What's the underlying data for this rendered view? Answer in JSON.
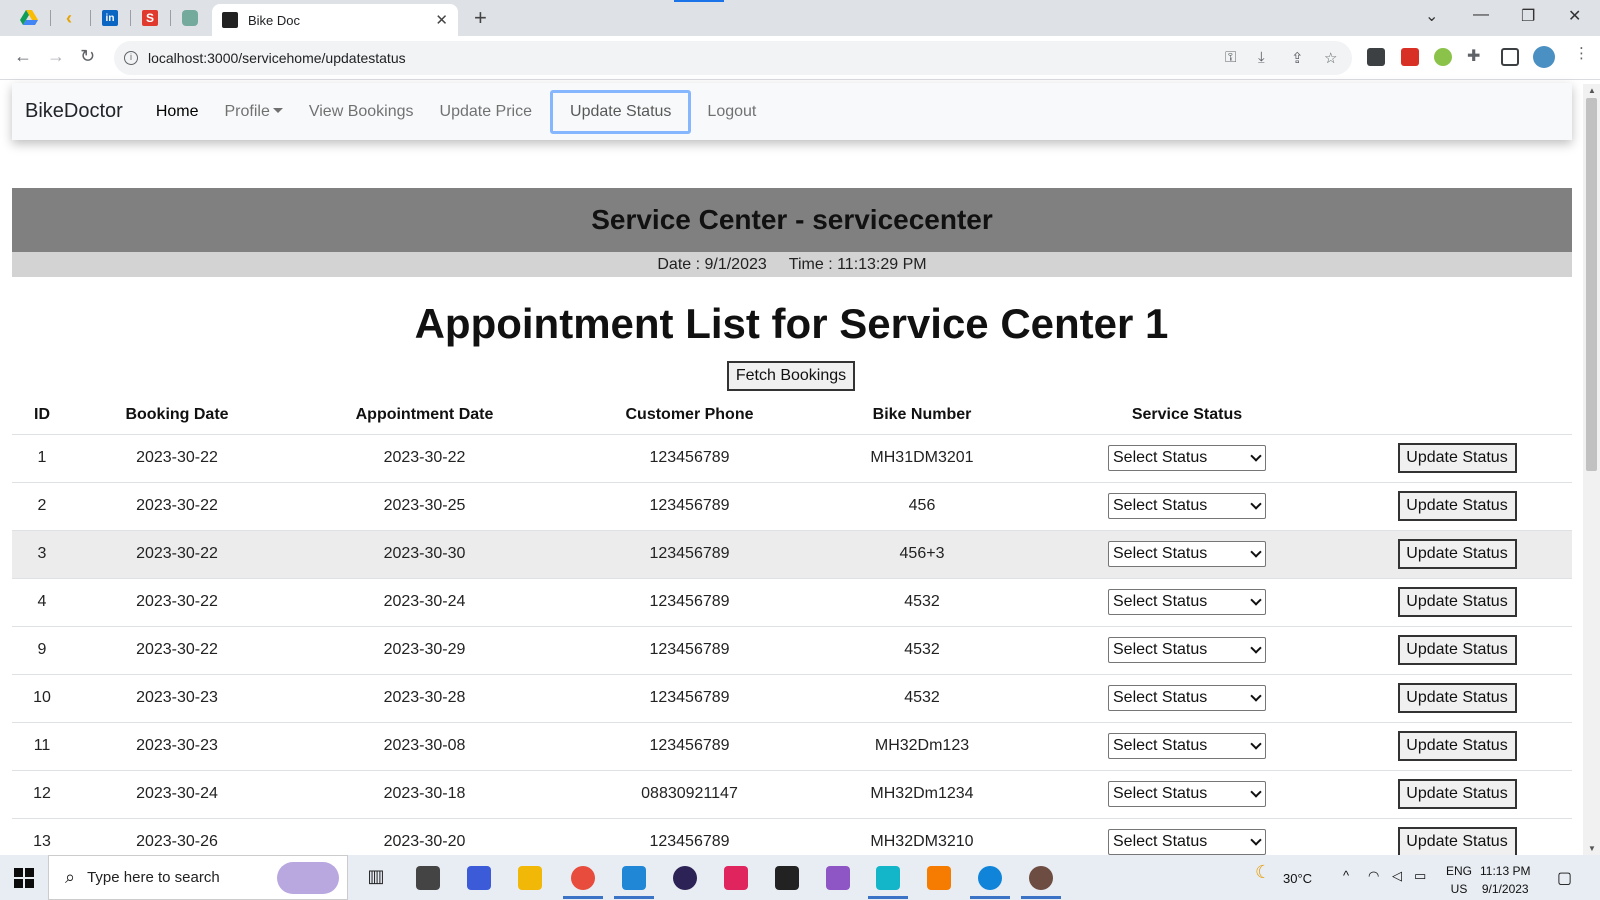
{
  "browser": {
    "tab_title": "Bike Doc",
    "url": "localhost:3000/servicehome/updatestatus",
    "new_tab": "+",
    "close_tab": "✕"
  },
  "nav": {
    "brand": "BikeDoctor",
    "home": "Home",
    "profile": "Profile",
    "view_bookings": "View Bookings",
    "update_price": "Update Price",
    "update_status": "Update Status",
    "logout": "Logout"
  },
  "header": {
    "center_title": "Service Center - servicecenter",
    "date": "Date : 9/1/2023",
    "time": "Time : 11:13:29 PM"
  },
  "main": {
    "heading": "Appointment List for Service Center 1",
    "fetch_button": "Fetch Bookings",
    "columns": [
      "ID",
      "Booking Date",
      "Appointment Date",
      "Customer Phone",
      "Bike Number",
      "Service Status"
    ],
    "select_label": "Select Status",
    "update_button": "Update Status",
    "rows": [
      {
        "id": "1",
        "booking": "2023-30-22",
        "appointment": "2023-30-22",
        "phone": "123456789",
        "bike": "MH31DM3201"
      },
      {
        "id": "2",
        "booking": "2023-30-22",
        "appointment": "2023-30-25",
        "phone": "123456789",
        "bike": "456"
      },
      {
        "id": "3",
        "booking": "2023-30-22",
        "appointment": "2023-30-30",
        "phone": "123456789",
        "bike": "456+3"
      },
      {
        "id": "4",
        "booking": "2023-30-22",
        "appointment": "2023-30-24",
        "phone": "123456789",
        "bike": "4532"
      },
      {
        "id": "9",
        "booking": "2023-30-22",
        "appointment": "2023-30-29",
        "phone": "123456789",
        "bike": "4532"
      },
      {
        "id": "10",
        "booking": "2023-30-23",
        "appointment": "2023-30-28",
        "phone": "123456789",
        "bike": "4532"
      },
      {
        "id": "11",
        "booking": "2023-30-23",
        "appointment": "2023-30-08",
        "phone": "123456789",
        "bike": "MH32Dm123"
      },
      {
        "id": "12",
        "booking": "2023-30-24",
        "appointment": "2023-30-18",
        "phone": "08830921147",
        "bike": "MH32Dm1234"
      },
      {
        "id": "13",
        "booking": "2023-30-26",
        "appointment": "2023-30-20",
        "phone": "123456789",
        "bike": "MH32DM3210"
      }
    ]
  },
  "taskbar": {
    "search_placeholder": "Type here to search",
    "weather": "30°C",
    "lang_1": "ENG",
    "lang_2": "US",
    "time": "11:13 PM",
    "date": "9/1/2023"
  }
}
